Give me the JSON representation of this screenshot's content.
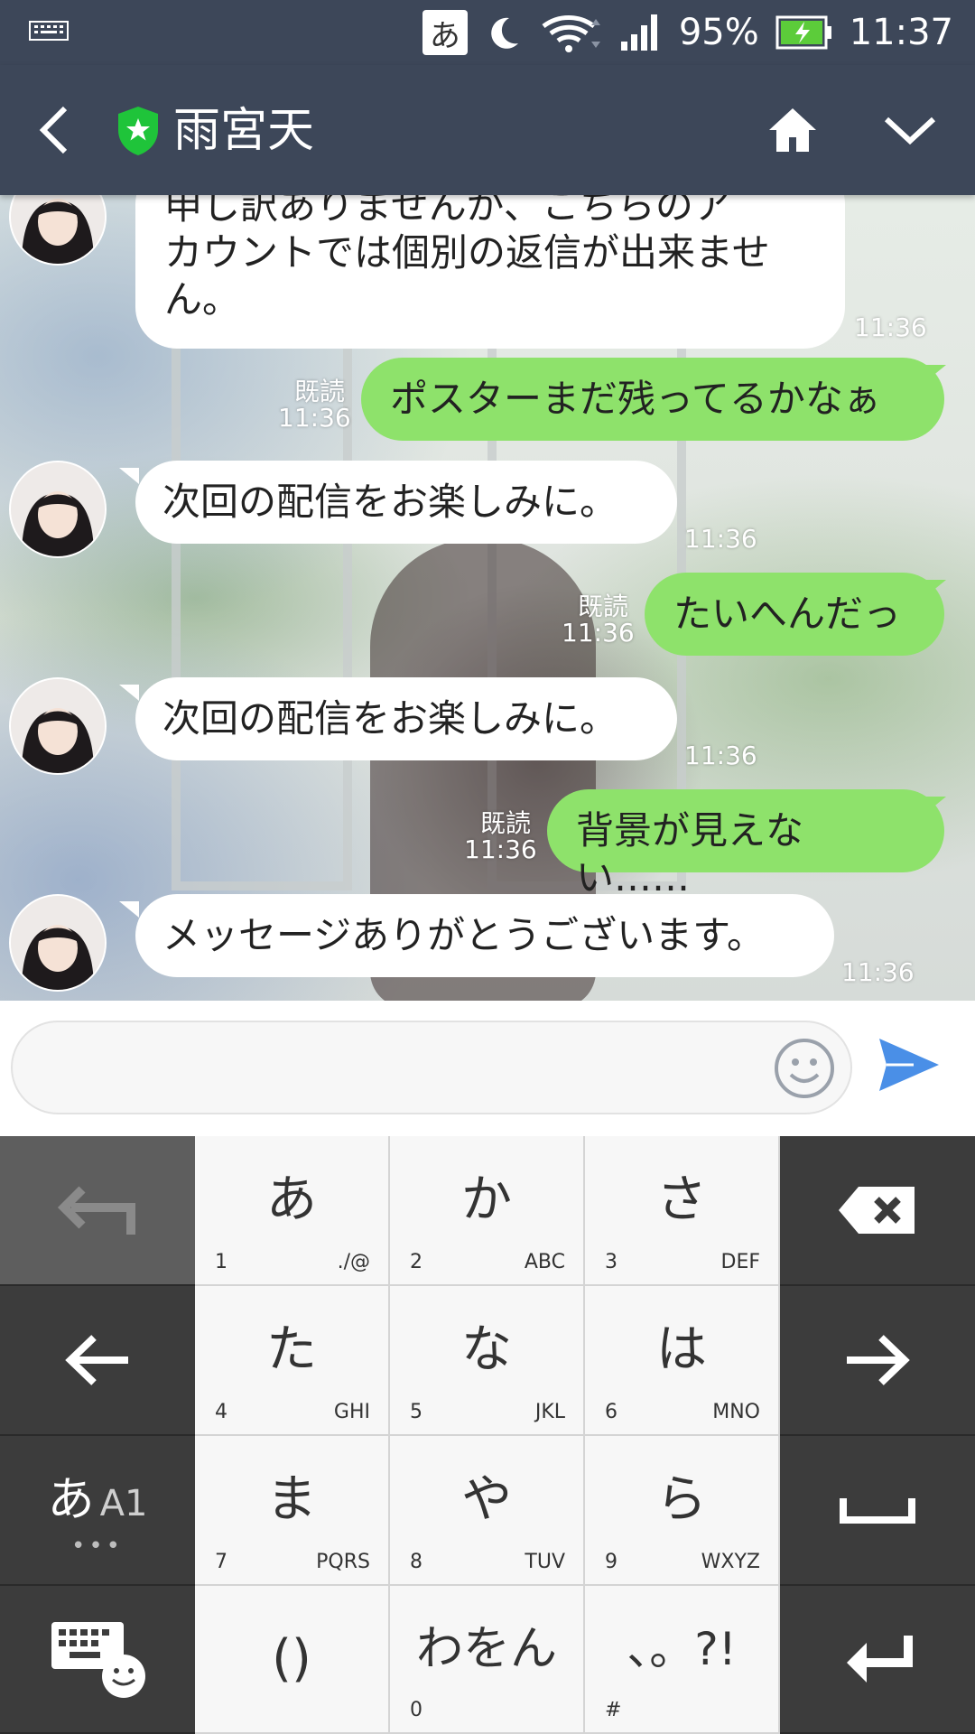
{
  "status_bar": {
    "ime": "あ",
    "battery": "95%",
    "time": "11:37"
  },
  "header": {
    "title": "雨宮天"
  },
  "messages": [
    {
      "side": "in",
      "text_lines": [
        "申し訳ありませんが、こちらのア",
        "カウントでは個別の返信が出来ませ",
        "ん。"
      ],
      "time": "11:36"
    },
    {
      "side": "out",
      "text": "ポスターまだ残ってるかなぁ",
      "read": "既読",
      "time": "11:36"
    },
    {
      "side": "in",
      "text": "次回の配信をお楽しみに。",
      "time": "11:36"
    },
    {
      "side": "out",
      "text": "たいへんだっ",
      "read": "既読",
      "time": "11:36"
    },
    {
      "side": "in",
      "text": "次回の配信をお楽しみに。",
      "time": "11:36"
    },
    {
      "side": "out",
      "text": "背景が見えない……",
      "read": "既読",
      "time": "11:36"
    },
    {
      "side": "in",
      "text": "メッセージありがとうございます。",
      "time": "11:36"
    }
  ],
  "input": {
    "value": "",
    "placeholder": ""
  },
  "keyboard": {
    "keys": [
      {
        "kana": "あ",
        "num": "1",
        "latin": "./@"
      },
      {
        "kana": "か",
        "num": "2",
        "latin": "ABC"
      },
      {
        "kana": "さ",
        "num": "3",
        "latin": "DEF"
      },
      {
        "kana": "た",
        "num": "4",
        "latin": "GHI"
      },
      {
        "kana": "な",
        "num": "5",
        "latin": "JKL"
      },
      {
        "kana": "は",
        "num": "6",
        "latin": "MNO"
      },
      {
        "kana": "ま",
        "num": "7",
        "latin": "PQRS"
      },
      {
        "kana": "や",
        "num": "8",
        "latin": "TUV"
      },
      {
        "kana": "ら",
        "num": "9",
        "latin": "WXYZ"
      },
      {
        "kana": "()",
        "num": "",
        "latin": ""
      },
      {
        "kana": "わをん",
        "num": "0",
        "latin": ""
      },
      {
        "kana": "、。?!",
        "num": "#",
        "latin": ""
      }
    ],
    "mode_label": "あ",
    "mode_sub": "A1",
    "mode_dots": "•••"
  },
  "colors": {
    "header_bg": "#3d4759",
    "out_bubble": "#8ee26b",
    "in_bubble": "#ffffff",
    "send_blue": "#4a8fe7",
    "official_green": "#1fc43a"
  }
}
